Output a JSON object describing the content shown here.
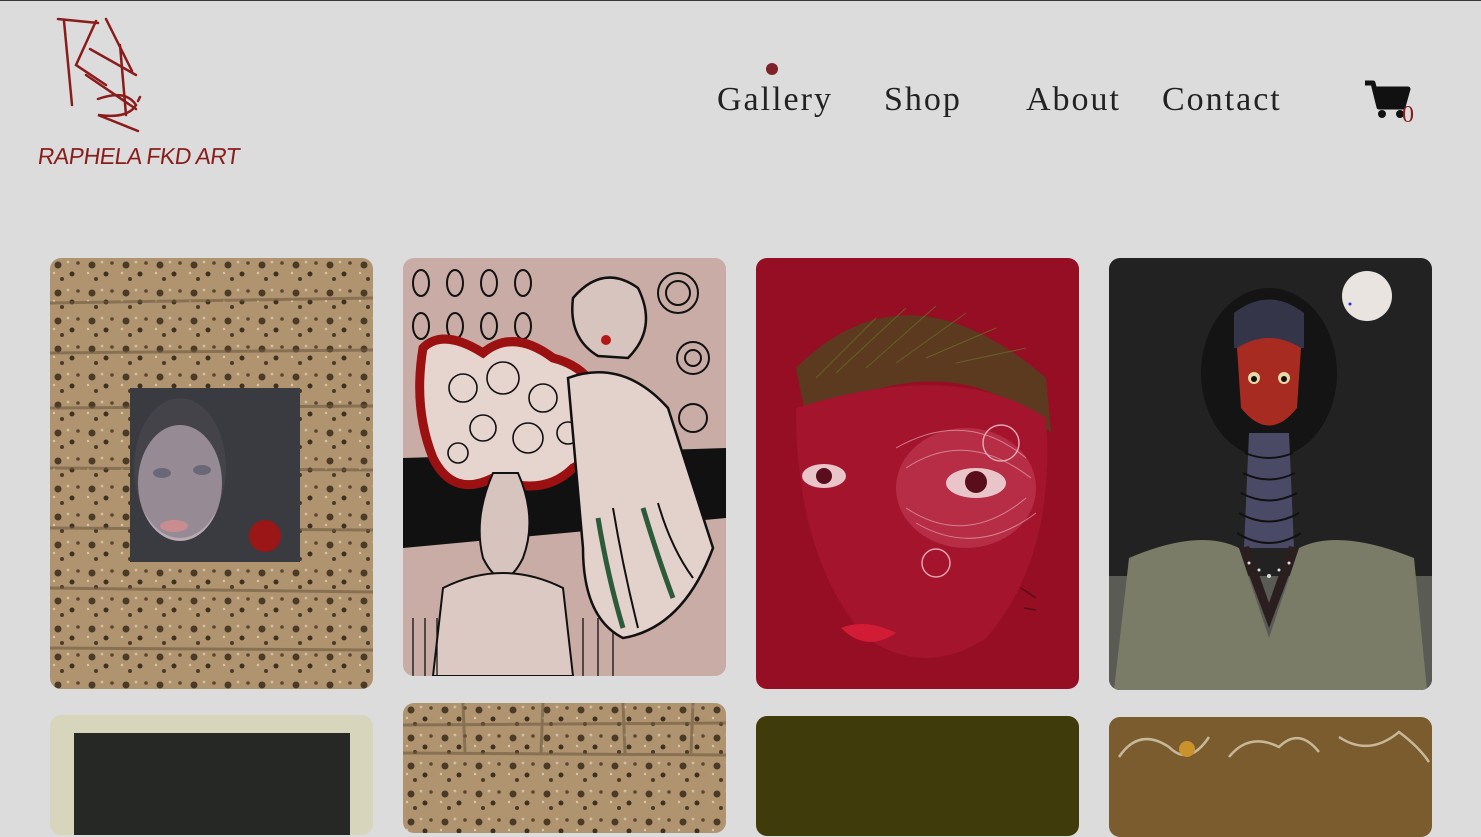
{
  "brand": {
    "logo_text": "RAPHELA FKD ART",
    "accent_color": "#8a1c1c"
  },
  "nav": {
    "items": [
      {
        "label": "Gallery",
        "active": true
      },
      {
        "label": "Shop"
      },
      {
        "label": "About"
      },
      {
        "label": "Contact"
      }
    ],
    "active_indicator_color": "#7e2227"
  },
  "cart": {
    "icon": "shopping-cart-icon",
    "count": "0"
  },
  "gallery": {
    "items": [
      {
        "subject": "portrait-canvas-on-stone-wall",
        "background": "#a68a66"
      },
      {
        "subject": "flowers-in-vase-with-woman-sketch",
        "background": "#c8aaa4"
      },
      {
        "subject": "red-face-portrait",
        "background": "#950e24"
      },
      {
        "subject": "red-faced-figure-with-moon",
        "background": "#2a2a2a"
      },
      {
        "subject": "framed-dark-artwork",
        "background": "#d7d6bc"
      },
      {
        "subject": "stone-wall",
        "background": "#a68a66"
      },
      {
        "subject": "olive-artwork",
        "background": "#3f3b0b"
      },
      {
        "subject": "branches-artwork",
        "background": "#7a5c2e"
      }
    ]
  }
}
